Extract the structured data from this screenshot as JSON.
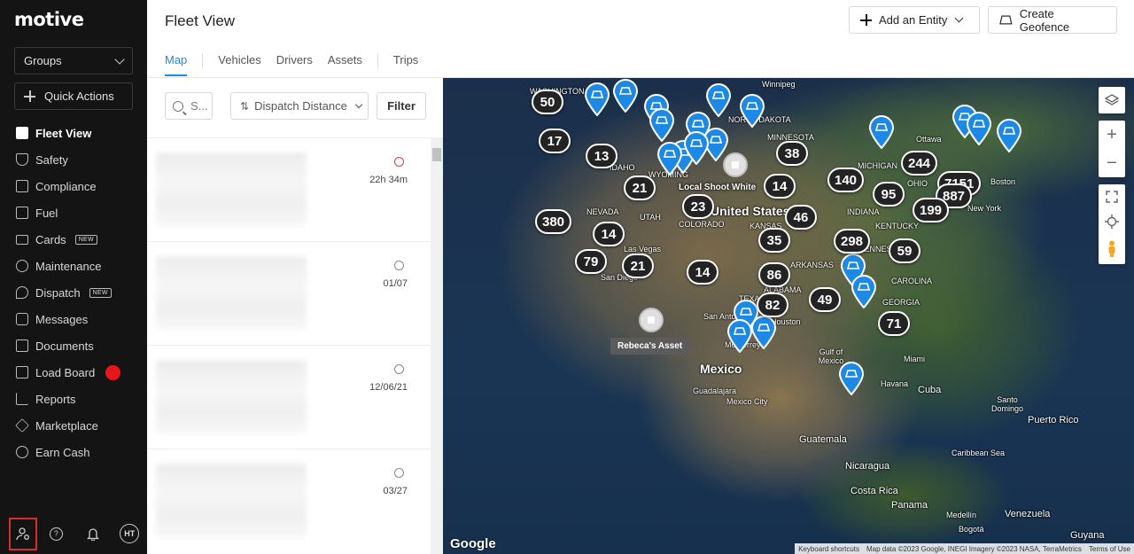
{
  "app": {
    "logo": "motive"
  },
  "sidebar": {
    "groups_label": "Groups",
    "quick_actions_label": "Quick Actions",
    "items": [
      {
        "label": "Fleet View",
        "active": true
      },
      {
        "label": "Safety"
      },
      {
        "label": "Compliance"
      },
      {
        "label": "Fuel"
      },
      {
        "label": "Cards",
        "badge": "NEW"
      },
      {
        "label": "Maintenance"
      },
      {
        "label": "Dispatch",
        "badge": "NEW"
      },
      {
        "label": "Messages"
      },
      {
        "label": "Documents"
      },
      {
        "label": "Load Board",
        "dot_color": "#e8151b"
      },
      {
        "label": "Reports"
      },
      {
        "label": "Marketplace"
      },
      {
        "label": "Earn Cash"
      }
    ],
    "bottom": {
      "help_glyph": "?",
      "avatar_initials": "HT"
    }
  },
  "header": {
    "title": "Fleet View",
    "add_entity_label": "Add an Entity",
    "create_geofence_label": "Create Geofence",
    "tabs": [
      "Map",
      "Vehicles",
      "Drivers",
      "Assets",
      "Trips"
    ],
    "active_tab": "Map"
  },
  "list_panel": {
    "search_placeholder": "S...",
    "sort_label": "Dispatch Distance",
    "filter_label": "Filter",
    "items": [
      {
        "time": "22h 34m",
        "alert": true
      },
      {
        "time": "01/07"
      },
      {
        "time": "12/06/21"
      },
      {
        "time": "03/27"
      }
    ]
  },
  "map": {
    "labels": {
      "winnipeg": "Winnipeg",
      "washington": "WASHINGTON",
      "north_dakota": "NORTH DAKOTA",
      "minnesota": "MINNESOTA",
      "idaho": "IDAHO",
      "wyoming": "WYOMING",
      "nevada": "NEVADA",
      "utah": "UTAH",
      "colorado": "COLORADO",
      "kansas": "KANSAS",
      "arkansas": "ARKANSAS",
      "texas": "TEXAS",
      "michigan": "MICHIGAN",
      "ohio": "OHIO",
      "indiana": "INDIANA",
      "kentucky": "KENTUCKY",
      "tennessee": "TENNESSEE",
      "carolina": "CAROLINA",
      "georgia": "GEORGIA",
      "alabama": "ALABAMA",
      "united_states": "United States",
      "ottawa": "Ottawa",
      "boston": "Boston",
      "new_york": "New York",
      "las_vegas": "Las Vegas",
      "san_diego": "San Diego",
      "san_antonio": "San Antonio",
      "houston": "Houston",
      "monterrey": "Monterrey",
      "mexico": "Mexico",
      "guadalajara": "Guadalajara",
      "mexico_city": "Mexico City",
      "gulf_of_mexico": "Gulf of Mexico",
      "miami": "Miami",
      "havana": "Havana",
      "cuba": "Cuba",
      "santo_domingo": "Santo Domingo",
      "puerto_rico": "Puerto Rico",
      "guatemala": "Guatemala",
      "caribbean_sea": "Caribbean Sea",
      "nicaragua": "Nicaragua",
      "costa_rica": "Costa Rica",
      "panama": "Panama",
      "medellin": "Medellín",
      "venezuela": "Venezuela",
      "bogota": "Bogotá",
      "guyana": "Guyana"
    },
    "clusters": [
      "50",
      "17",
      "13",
      "21",
      "380",
      "14",
      "79",
      "21",
      "23",
      "14",
      "38",
      "14",
      "46",
      "35",
      "86",
      "82",
      "140",
      "95",
      "244",
      "7151",
      "887",
      "199",
      "298",
      "59",
      "49",
      "71"
    ],
    "assets": {
      "local_shoot_white": "Local Shoot White",
      "rebecas_asset": "Rebeca's Asset"
    },
    "google": "Google",
    "attribution": {
      "shortcuts": "Keyboard shortcuts",
      "data": "Map data ©2023 Google, INEGI Imagery ©2023 NASA, TerraMetrics",
      "terms": "Terms of Use"
    },
    "pin_color": "#1e88e5"
  }
}
